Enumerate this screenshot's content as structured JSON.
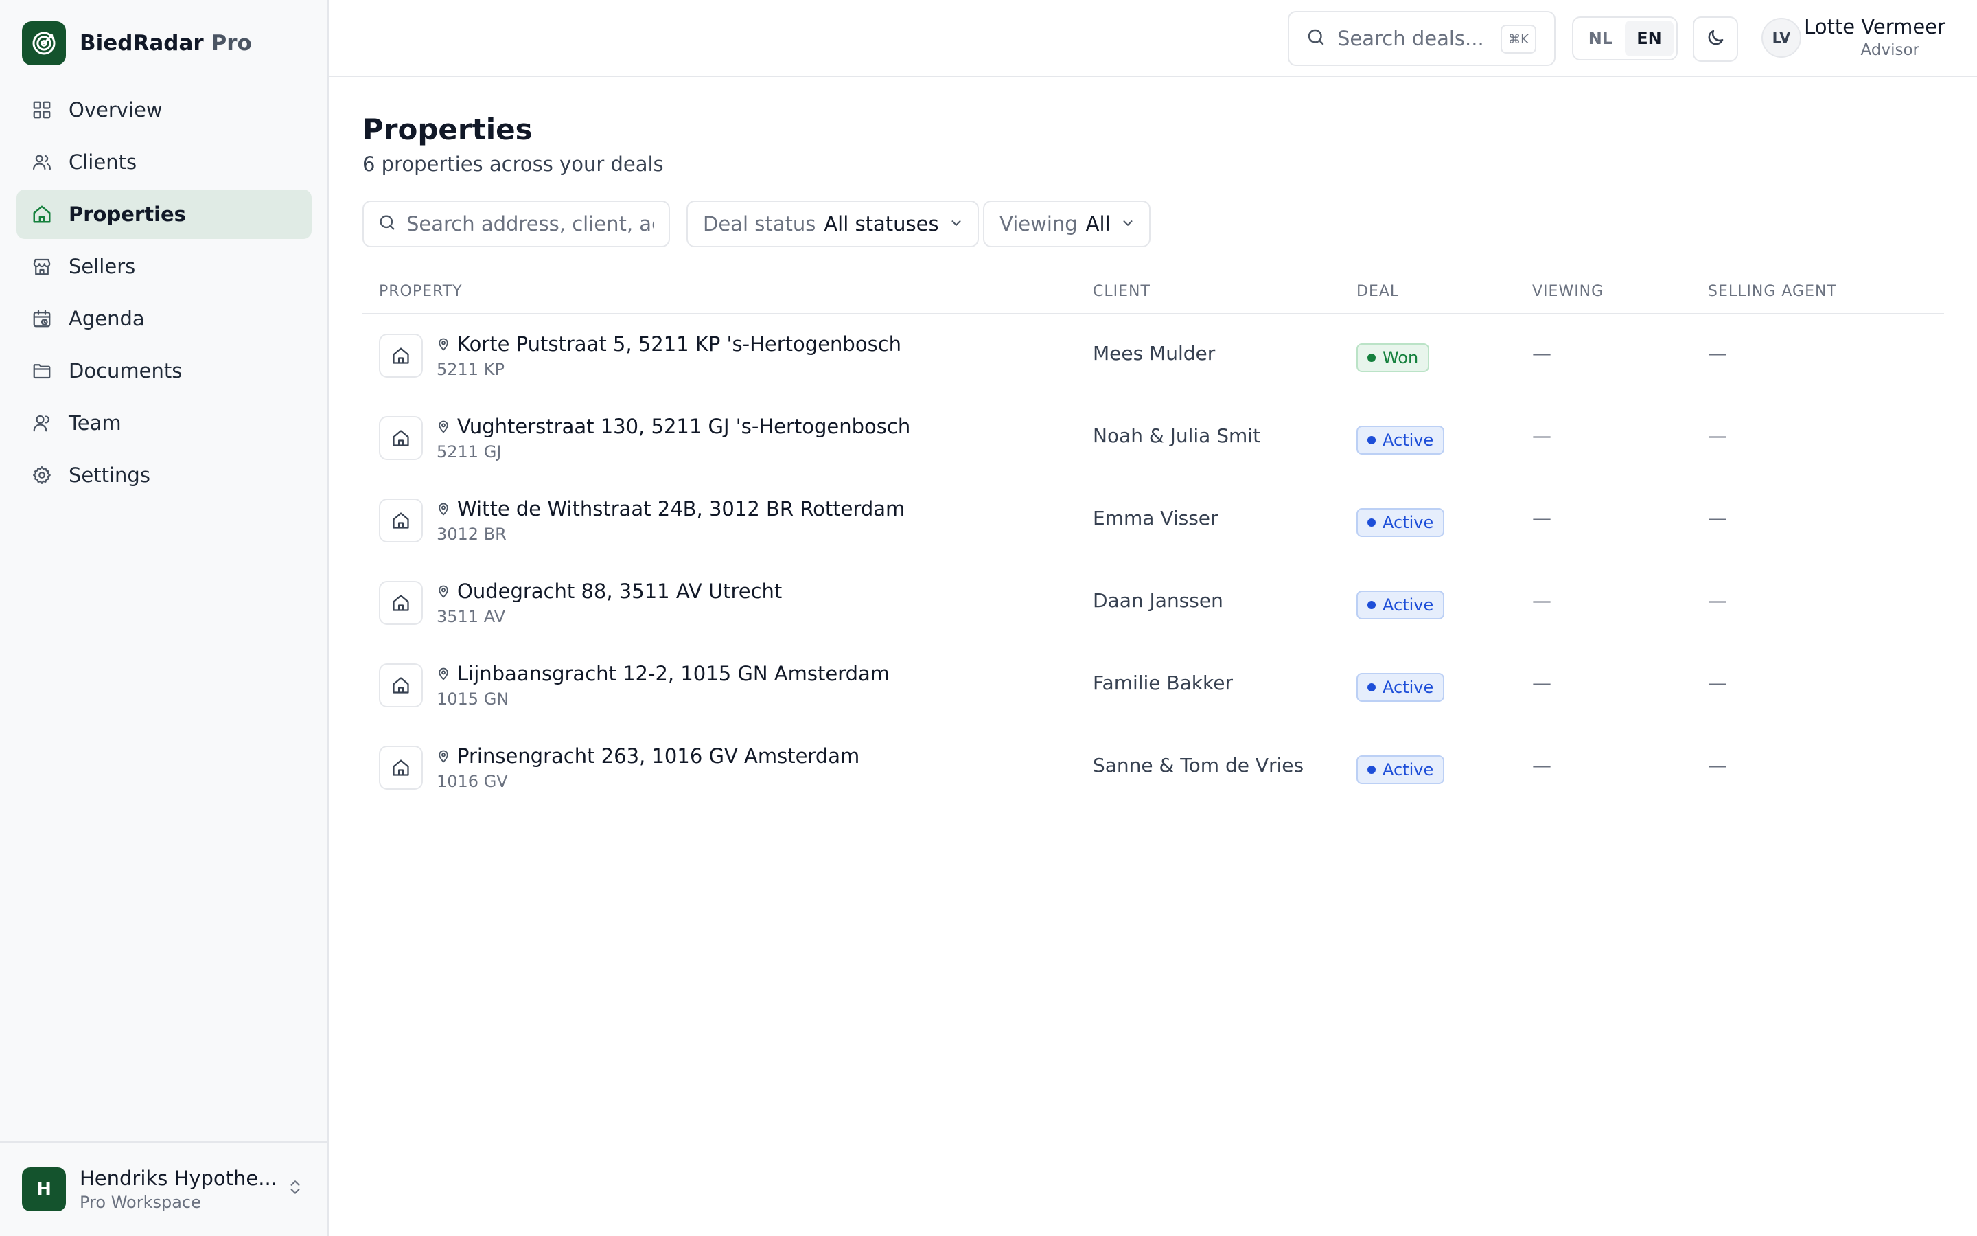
{
  "brand": {
    "name": "BiedRadar",
    "suffix": "Pro",
    "accent": "#14532d"
  },
  "sidebar": {
    "items": [
      {
        "label": "Overview",
        "icon": "grid-icon",
        "active": false
      },
      {
        "label": "Clients",
        "icon": "users-icon",
        "active": false
      },
      {
        "label": "Properties",
        "icon": "home-icon",
        "active": true
      },
      {
        "label": "Sellers",
        "icon": "store-icon",
        "active": false
      },
      {
        "label": "Agenda",
        "icon": "calendar-icon",
        "active": false
      },
      {
        "label": "Documents",
        "icon": "folder-icon",
        "active": false
      },
      {
        "label": "Team",
        "icon": "user-icon",
        "active": false
      },
      {
        "label": "Settings",
        "icon": "gear-icon",
        "active": false
      }
    ]
  },
  "workspace": {
    "initial": "H",
    "name": "Hendriks Hypothe...",
    "plan": "Pro Workspace"
  },
  "header": {
    "search_placeholder": "Search deals...",
    "shortcut": "⌘K",
    "languages": [
      {
        "label": "NL",
        "active": false
      },
      {
        "label": "EN",
        "active": true
      }
    ],
    "user": {
      "initials": "LV",
      "name": "Lotte Vermeer",
      "role": "Advisor"
    }
  },
  "page": {
    "title": "Properties",
    "subtitle": "6 properties across your deals"
  },
  "filters": {
    "search_placeholder": "Search address, client, agent...",
    "deal_status": {
      "label": "Deal status",
      "value": "All statuses"
    },
    "viewing": {
      "label": "Viewing",
      "value": "All"
    }
  },
  "table": {
    "columns": {
      "property": "PROPERTY",
      "client": "CLIENT",
      "deal": "DEAL",
      "viewing": "VIEWING",
      "agent": "SELLING AGENT"
    },
    "rows": [
      {
        "address": "Korte Putstraat 5, 5211 KP 's-Hertogenbosch",
        "postcode": "5211 KP",
        "client": "Mees Mulder",
        "deal": "Won",
        "deal_kind": "won",
        "viewing": "—",
        "agent": "—"
      },
      {
        "address": "Vughterstraat 130, 5211 GJ 's-Hertogenbosch",
        "postcode": "5211 GJ",
        "client": "Noah & Julia Smit",
        "deal": "Active",
        "deal_kind": "active",
        "viewing": "—",
        "agent": "—"
      },
      {
        "address": "Witte de Withstraat 24B, 3012 BR Rotterdam",
        "postcode": "3012 BR",
        "client": "Emma Visser",
        "deal": "Active",
        "deal_kind": "active",
        "viewing": "—",
        "agent": "—"
      },
      {
        "address": "Oudegracht 88, 3511 AV Utrecht",
        "postcode": "3511 AV",
        "client": "Daan Janssen",
        "deal": "Active",
        "deal_kind": "active",
        "viewing": "—",
        "agent": "—"
      },
      {
        "address": "Lijnbaansgracht 12-2, 1015 GN Amsterdam",
        "postcode": "1015 GN",
        "client": "Familie Bakker",
        "deal": "Active",
        "deal_kind": "active",
        "viewing": "—",
        "agent": "—"
      },
      {
        "address": "Prinsengracht 263, 1016 GV Amsterdam",
        "postcode": "1016 GV",
        "client": "Sanne & Tom de Vries",
        "deal": "Active",
        "deal_kind": "active",
        "viewing": "—",
        "agent": "—"
      }
    ]
  }
}
